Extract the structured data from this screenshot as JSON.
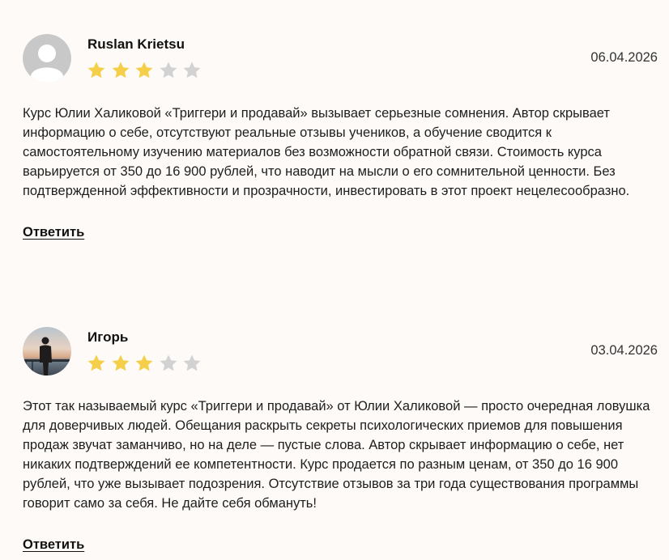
{
  "reviews": [
    {
      "author": "Ruslan Krietsu",
      "date": "06.04.2026",
      "rating": 3,
      "max_rating": 5,
      "avatar": "default-user-avatar",
      "text": "Курс Юлии Халиковой «Триггери и продавай» вызывает серьезные сомнения. Автор скрывает информацию о себе, отсутствуют реальные отзывы учеников, а обучение сводится к самостоятельному изучению материалов без возможности обратной связи. Стоимость курса варьируется от 350 до 16 900 рублей, что наводит на мысли о его сомнительной ценности. Без подтвержденной эффективности и прозрачности, инвестировать в этот проект нецелесообразно.",
      "reply_label": "Ответить"
    },
    {
      "author": "Игорь",
      "date": "03.04.2026",
      "rating": 3,
      "max_rating": 5,
      "avatar": "photo-avatar",
      "text": "Этот так называемый курс «Триггери и продавай» от Юлии Халиковой — просто очередная ловушка для доверчивых людей. Обещания раскрыть секреты психологических приемов для повышения продаж звучат заманчиво, но на деле — пустые слова. Автор скрывает информацию о себе, нет никаких подтверждений ее компетентности. Курс продается по разным ценам, от 350 до 16 900 рублей, что уже вызывает подозрения. Отсутствие отзывов за три года существования программы говорит само за себя. Не дайте себя обмануть!",
      "reply_label": "Ответить"
    }
  ],
  "colors": {
    "background": "#fdfaf7",
    "star_filled": "#f5cf4a",
    "star_empty": "#d2d2d2",
    "avatar_placeholder": "#c8c8c8"
  }
}
